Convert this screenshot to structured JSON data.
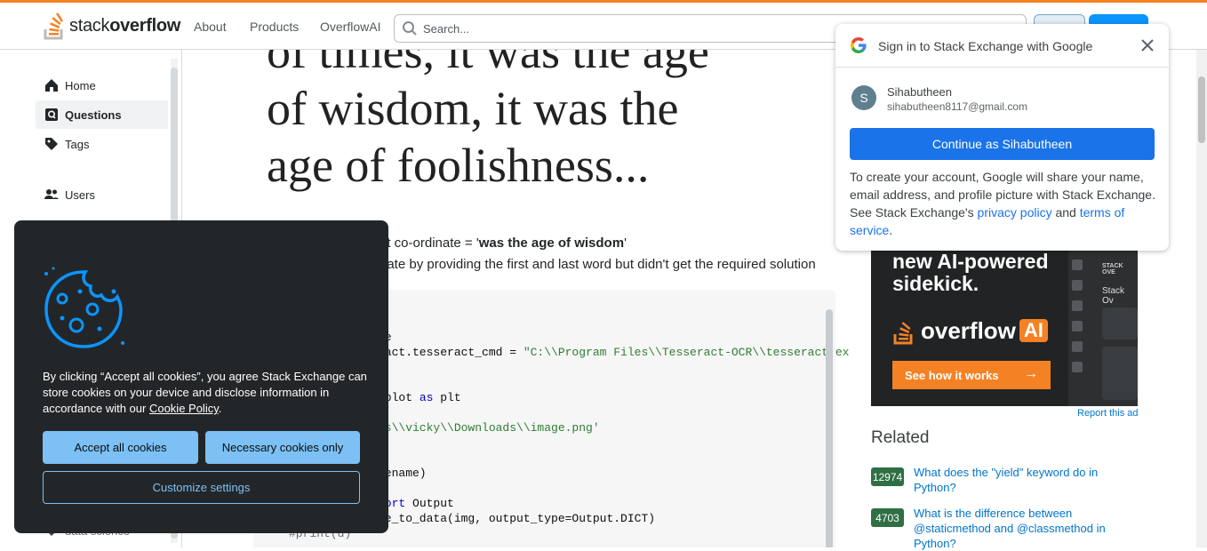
{
  "header": {
    "logo_text_light": "stack",
    "logo_text_bold": "overflow",
    "nav": [
      "About",
      "Products",
      "OverflowAI"
    ],
    "search_placeholder": "Search..."
  },
  "leftnav": {
    "items": [
      {
        "label": "Home",
        "icon": "home-icon"
      },
      {
        "label": "Questions",
        "icon": "questions-icon",
        "active": true
      },
      {
        "label": "Tags",
        "icon": "tag-icon"
      },
      {
        "label": "Users",
        "icon": "users-icon"
      }
    ],
    "partial_label": "data science"
  },
  "question": {
    "image_lines": [
      "of times, it was the age",
      "of wisdom, it was the",
      "age of foolishness..."
    ],
    "target_prefix": "et co-ordinate = '",
    "target_bold": "was the age of wisdom",
    "target_suffix": "'",
    "line2": "nate by providing the first and last word but didn't get the required solution",
    "code": {
      "l1": "ge",
      "l2a": "ract.tesseract_cmd = ",
      "l2b": "\"C:\\\\Program Files\\\\Tesseract-OCR\\\\tesseract.exe",
      "l3a": "yplot ",
      "l3b": "as",
      "l3c": " plt",
      "l4": "rs\\\\vicky\\\\Downloads\\\\image.png'",
      "l5": "lename)",
      "l6a": "port",
      "l6b": " Output",
      "l7": "ge_to_data(img, output_type=Output.DICT)",
      "l8": "#print(d)"
    }
  },
  "ad": {
    "title_line1": "new AI-powered",
    "title_line2": "sidekick.",
    "brand": "overflow",
    "brand_ai": "AI",
    "cta": "See how it works",
    "side_title": "STACK OVE",
    "side_sub": "Stack Ov",
    "report": "Report this ad"
  },
  "related": {
    "heading": "Related",
    "items": [
      {
        "score": "12974",
        "title": "What does the \"yield\" keyword do in Python?"
      },
      {
        "score": "4703",
        "title": "What is the difference between @staticmethod and @classmethod in Python?"
      }
    ]
  },
  "google_popup": {
    "title": "Sign in to Stack Exchange with Google",
    "avatar_letter": "S",
    "name": "Sihabutheen",
    "email": "sihabutheen8117@gmail.com",
    "continue_label": "Continue as Sihabutheen",
    "desc_before": "To create your account, Google will share your name, email address, and profile picture with Stack Exchange. See Stack Exchange's ",
    "privacy_label": "privacy policy",
    "desc_and": " and ",
    "terms_label": "terms of service",
    "desc_end": "."
  },
  "cookie": {
    "text_before": "By clicking “Accept all cookies”, you agree Stack Exchange can store cookies on your device and disclose information in accordance with our ",
    "policy_link": "Cookie Policy",
    "text_end": ".",
    "accept_label": "Accept all cookies",
    "necessary_label": "Necessary cookies only",
    "customize_label": "Customize settings"
  },
  "colors": {
    "brand_orange": "#f48225",
    "link_blue": "#0074cc",
    "google_blue": "#1a73e8",
    "cookie_bg": "#232629",
    "cookie_button": "#7cc0f4"
  }
}
